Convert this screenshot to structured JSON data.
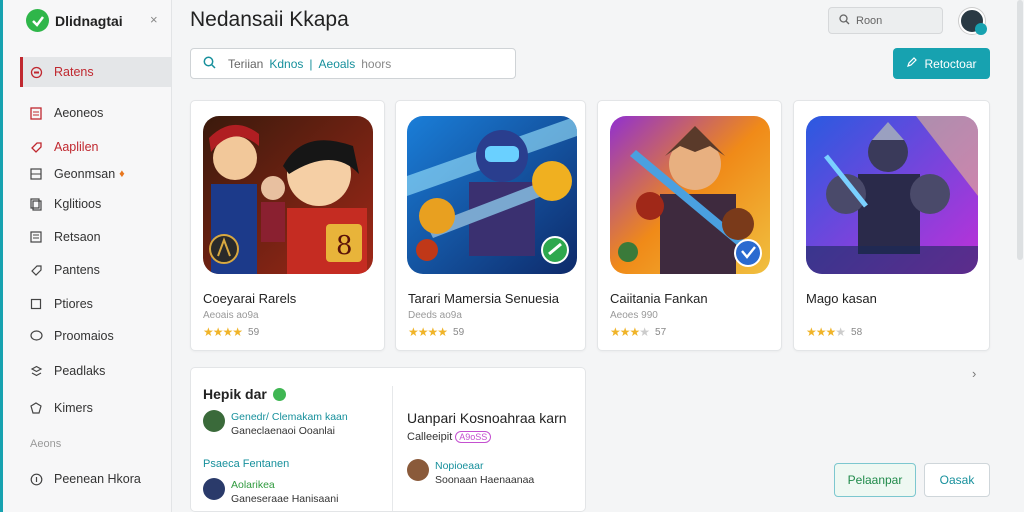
{
  "sidebar": {
    "brand": "Dlidnagtai",
    "close": "×",
    "items": [
      {
        "label": "Ratens",
        "icon": "circle-icon"
      },
      {
        "label": "Aeoneos",
        "icon": "document-icon"
      },
      {
        "label": "Aaplilen",
        "icon": "tag-icon"
      },
      {
        "label": "Geonmsan",
        "icon": "grid-icon"
      },
      {
        "label": "Kglitioos",
        "icon": "layers-icon"
      },
      {
        "label": "Retsaon",
        "icon": "list-icon"
      },
      {
        "label": "Pantens",
        "icon": "tag-icon"
      },
      {
        "label": "Ptiores",
        "icon": "square-icon"
      },
      {
        "label": "Proomaios",
        "icon": "speech-icon"
      },
      {
        "label": "Peadlaks",
        "icon": "stack-icon"
      },
      {
        "label": "Kimers",
        "icon": "shield-icon"
      }
    ],
    "section_label": "Aeons",
    "footer_item": {
      "label": "Peenean Hkora",
      "icon": "info-icon"
    }
  },
  "header": {
    "title": "Nedansaii Kkapa",
    "search_placeholder": "Roon"
  },
  "search": {
    "part1": "Teriian",
    "part2": "Kdnos",
    "separator": "|",
    "part3": "Aeoals",
    "part4": "hoors"
  },
  "primary_button": "Retoctoar",
  "cards": [
    {
      "title": "Coeyarai Rarels",
      "sub": "Aeoais ao9a",
      "rating": 4,
      "count": "59"
    },
    {
      "title": "Tarari Mamersia Senuesia",
      "sub": "Deeds ao9a",
      "rating": 4,
      "count": "59"
    },
    {
      "title": "Caiitania Fankan",
      "sub": "Aeoes 990",
      "rating": 3.5,
      "count": "57"
    },
    {
      "title": "Mago kasan",
      "sub": "",
      "rating": 3.5,
      "count": "58"
    }
  ],
  "panel": {
    "title": "Hepik dar",
    "feed": [
      {
        "line1": "Genedr/ Clemakam kaan",
        "line2": "Ganeclaenaoi Ooanlai"
      },
      {
        "line1": "Aolarikea",
        "line2": "Ganeseraae Hanisaani"
      }
    ],
    "feed_link": "Psaeca Fentanen",
    "right_title": "Uanpari Kosnoahraa karn",
    "right_tagline": "Calleeipit",
    "right_pill": "A9oSS",
    "right_item": {
      "line1": "Nopioeaar",
      "line2": "Soonaan Haenaanaa"
    }
  },
  "buttons": {
    "secondary": "Pelaanpar",
    "tertiary": "Oasak"
  },
  "colors": {
    "accent": "#17a2b0",
    "active": "#c0282f",
    "star": "#f0b429"
  }
}
